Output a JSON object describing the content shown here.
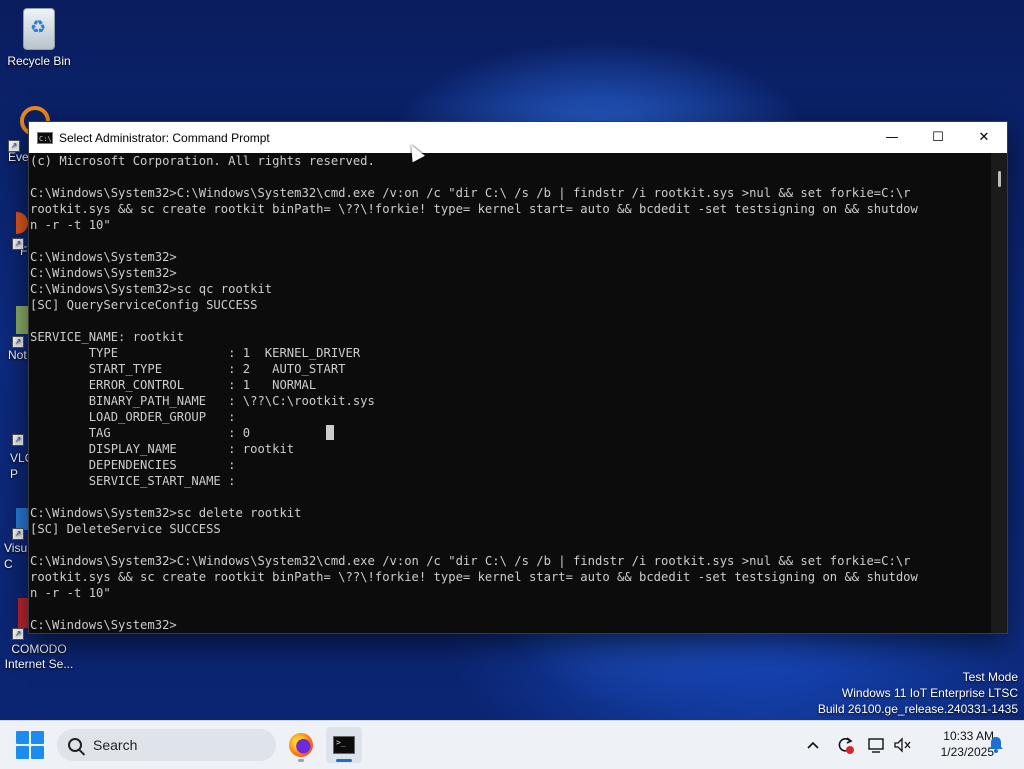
{
  "desktop": {
    "icons": [
      {
        "label": "Recycle Bin"
      },
      {
        "label": "Eve"
      },
      {
        "label": "F"
      },
      {
        "label": "Not"
      },
      {
        "label": "VLC\nP"
      },
      {
        "label": "Visu\nC"
      },
      {
        "label": "COMODO\nInternet Se..."
      }
    ]
  },
  "window": {
    "title": "Select Administrator: Command Prompt",
    "minimize_glyph": "—",
    "maximize_glyph": "☐",
    "close_glyph": "✕"
  },
  "terminal": {
    "lines": [
      "(c) Microsoft Corporation. All rights reserved.",
      "",
      "C:\\Windows\\System32>C:\\Windows\\System32\\cmd.exe /v:on /c \"dir C:\\ /s /b | findstr /i rootkit.sys >nul && set forkie=C:\\r",
      "rootkit.sys && sc create rootkit binPath= \\??\\!forkie! type= kernel start= auto && bcdedit -set testsigning on && shutdow",
      "n -r -t 10\"",
      "",
      "C:\\Windows\\System32>",
      "C:\\Windows\\System32>",
      "C:\\Windows\\System32>sc qc rootkit",
      "[SC] QueryServiceConfig SUCCESS",
      "",
      "SERVICE_NAME: rootkit",
      "        TYPE               : 1  KERNEL_DRIVER",
      "        START_TYPE         : 2   AUTO_START",
      "        ERROR_CONTROL      : 1   NORMAL",
      "        BINARY_PATH_NAME   : \\??\\C:\\rootkit.sys",
      "        LOAD_ORDER_GROUP   :",
      "        TAG                : 0",
      "        DISPLAY_NAME       : rootkit",
      "        DEPENDENCIES       :",
      "        SERVICE_START_NAME :",
      "",
      "C:\\Windows\\System32>sc delete rootkit",
      "[SC] DeleteService SUCCESS",
      "",
      "C:\\Windows\\System32>C:\\Windows\\System32\\cmd.exe /v:on /c \"dir C:\\ /s /b | findstr /i rootkit.sys >nul && set forkie=C:\\r",
      "rootkit.sys && sc create rootkit binPath= \\??\\!forkie! type= kernel start= auto && bcdedit -set testsigning on && shutdow",
      "n -r -t 10\"",
      "",
      "C:\\Windows\\System32>"
    ]
  },
  "watermark": {
    "line1": "Test Mode",
    "line2": "Windows 11 IoT Enterprise LTSC",
    "line3": "Build 26100.ge_release.240331-1435"
  },
  "taskbar": {
    "search_placeholder": "Search",
    "tray_chevron": "^",
    "time": "10:33 AM",
    "date": "1/23/2025"
  },
  "colors": {
    "terminal_bg": "#0c0c0c",
    "terminal_fg": "#cccccc",
    "accent": "#1d6fd0"
  }
}
